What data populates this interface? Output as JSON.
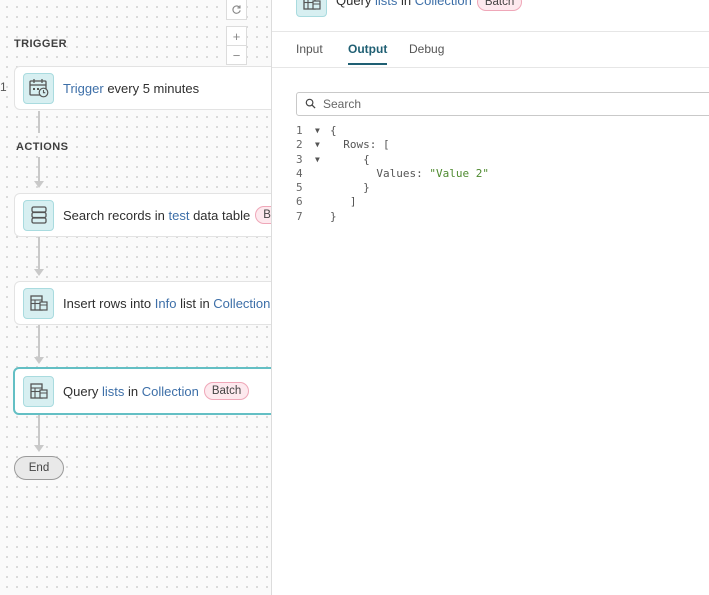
{
  "canvas": {
    "edge_number": "1",
    "trigger_label": "TRIGGER",
    "actions_label": "ACTIONS",
    "trigger_node": {
      "link": "Trigger",
      "text": " every 5 minutes"
    },
    "search_node": {
      "text1": "Search records in ",
      "link": "test",
      "text2": " data table",
      "badge": "Ba"
    },
    "insert_node": {
      "text1": "Insert rows into ",
      "link1": "Info",
      "text2": " list in ",
      "link2": "Collection"
    },
    "query_node": {
      "text1": "Query ",
      "link1": "lists",
      "text2": " in ",
      "link2": "Collection",
      "badge": "Batch"
    },
    "end_label": "End",
    "controls": {
      "zoom_in": "+",
      "zoom_out": "−"
    }
  },
  "panel": {
    "header": {
      "text1": "Query ",
      "link1": "lists",
      "text2": " in ",
      "link2": "Collection",
      "badge": "Batch"
    },
    "tabs": [
      {
        "label": "Input"
      },
      {
        "label": "Output"
      },
      {
        "label": "Debug"
      }
    ],
    "active_tab": "Output",
    "search": {
      "placeholder": "Search",
      "value": ""
    },
    "code_lines": [
      {
        "num": "1",
        "fold": "▼",
        "text": "{"
      },
      {
        "num": "2",
        "fold": "▼",
        "text": "  Rows: ["
      },
      {
        "num": "3",
        "fold": "▼",
        "text": "     {"
      },
      {
        "num": "4",
        "fold": "",
        "key": "       Values: ",
        "value": "\"Value 2\""
      },
      {
        "num": "5",
        "fold": "",
        "text": "     }"
      },
      {
        "num": "6",
        "fold": "",
        "text": "   ]"
      },
      {
        "num": "7",
        "fold": "",
        "text": "}"
      }
    ]
  },
  "colors": {
    "accent": "#1f5f73",
    "link": "#3d6fa8",
    "icon_bg": "#d7eff1",
    "active_border": "#63bfc4",
    "badge_bg": "#fde9ee",
    "badge_border": "#efa7b8",
    "string": "#4e8a2f"
  },
  "icons": {
    "trigger": "calendar-clock-icon",
    "search": "database-icon",
    "insert": "list-table-icon",
    "query": "list-table-icon",
    "reset": "refresh-icon",
    "fit": "fit-view-icon",
    "search_field": "search-icon"
  }
}
